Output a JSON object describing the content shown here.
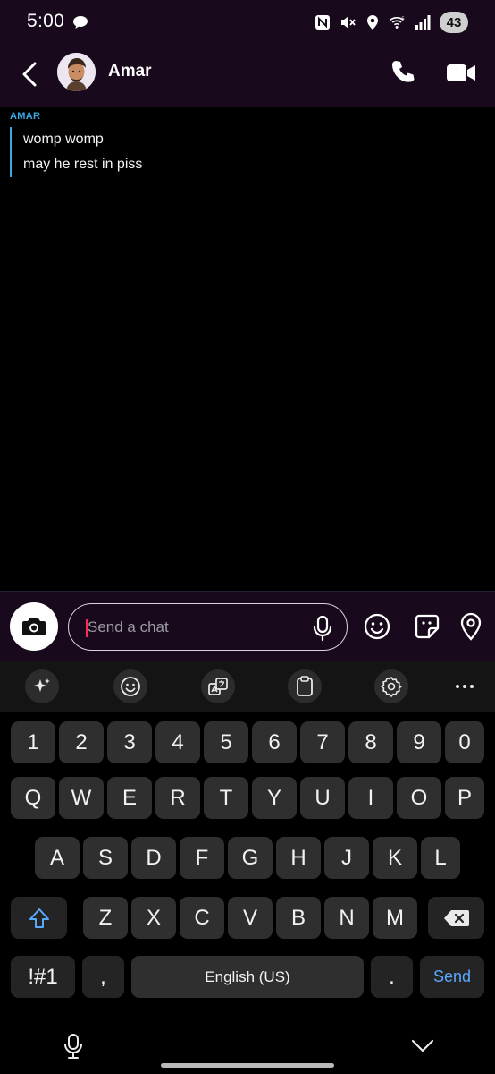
{
  "status_bar": {
    "time": "5:00",
    "battery": "43",
    "icons": [
      "message-icon",
      "nfc-icon",
      "mute-icon",
      "location-icon",
      "wifi-icon",
      "signal-icon"
    ]
  },
  "chat_header": {
    "contact_name": "Amar",
    "icons": [
      "back-arrow-icon",
      "avatar",
      "phone-icon",
      "video-camera-icon"
    ]
  },
  "messages": {
    "sender": "AMAR",
    "items": [
      "womp womp",
      "may he rest in piss"
    ],
    "accent_color": "#3aa9e6"
  },
  "input_bar": {
    "placeholder": "Send a chat",
    "icons": [
      "camera-icon",
      "microphone-icon",
      "emoji-icon",
      "sticker-icon",
      "location-pin-icon"
    ]
  },
  "keyboard_toolbar": {
    "icons": [
      "sparkle-ai-icon",
      "emoji-icon",
      "translate-icon",
      "clipboard-icon",
      "settings-gear-icon",
      "more-icon"
    ]
  },
  "keyboard": {
    "rows": [
      [
        "1",
        "2",
        "3",
        "4",
        "5",
        "6",
        "7",
        "8",
        "9",
        "0"
      ],
      [
        "Q",
        "W",
        "E",
        "R",
        "T",
        "Y",
        "U",
        "I",
        "O",
        "P"
      ],
      [
        "A",
        "S",
        "D",
        "F",
        "G",
        "H",
        "J",
        "K",
        "L"
      ],
      [
        "Z",
        "X",
        "C",
        "V",
        "B",
        "N",
        "M"
      ]
    ],
    "symbols_label": "!#1",
    "comma_label": ",",
    "space_label": "English (US)",
    "period_label": ".",
    "send_label": "Send",
    "send_color": "#5aa7ff"
  },
  "nav_bar": {
    "icons": [
      "voice-input-icon",
      "hide-keyboard-icon"
    ]
  }
}
